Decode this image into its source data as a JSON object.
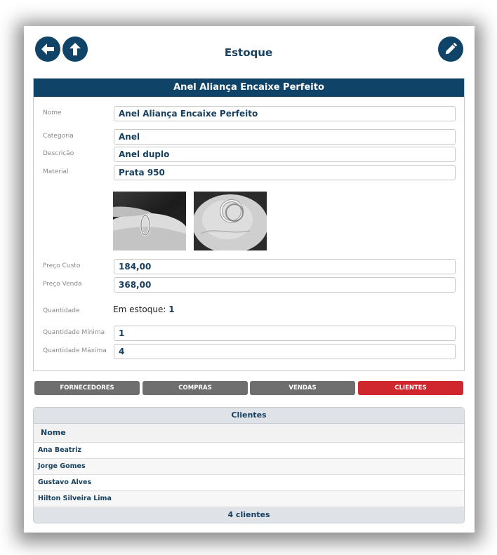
{
  "header": {
    "title": "Estoque",
    "back_icon": "arrow-left-icon",
    "up_icon": "arrow-up-icon",
    "edit_icon": "pencil-icon"
  },
  "product": {
    "card_title": "Anel Aliança Encaixe Perfeito",
    "fields": {
      "nome": {
        "label": "Nome",
        "value": "Anel Aliança Encaixe Perfeito"
      },
      "categoria": {
        "label": "Categoria",
        "value": "Anel"
      },
      "descricao": {
        "label": "Descricão",
        "value": "Anel duplo"
      },
      "material": {
        "label": "Material",
        "value": "Prata 950"
      },
      "preco_custo": {
        "label": "Preço Custo",
        "value": "184,00"
      },
      "preco_venda": {
        "label": "Preço Venda",
        "value": "368,00"
      },
      "quantidade": {
        "label": "Quantidade",
        "prefix": "Em estoque:",
        "value": "1"
      },
      "quantidade_minima": {
        "label": "Quantidade Mínima",
        "value": "1"
      },
      "quantidade_maxima": {
        "label": "Quantidade Máxima",
        "value": "4"
      }
    }
  },
  "tabs": [
    {
      "label": "FORNECEDORES",
      "active": false
    },
    {
      "label": "COMPRAS",
      "active": false
    },
    {
      "label": "VENDAS",
      "active": false
    },
    {
      "label": "CLIENTES",
      "active": true
    }
  ],
  "clients": {
    "title": "Clientes",
    "column": "Nome",
    "rows": [
      "Ana Beatriz",
      "Jorge Gomes",
      "Gustavo Alves",
      "Hilton Silveira Lima"
    ],
    "footer": "4 clientes"
  },
  "colors": {
    "primary": "#0f4367",
    "tab_inactive": "#6e6e6e",
    "tab_active": "#d0272e"
  }
}
